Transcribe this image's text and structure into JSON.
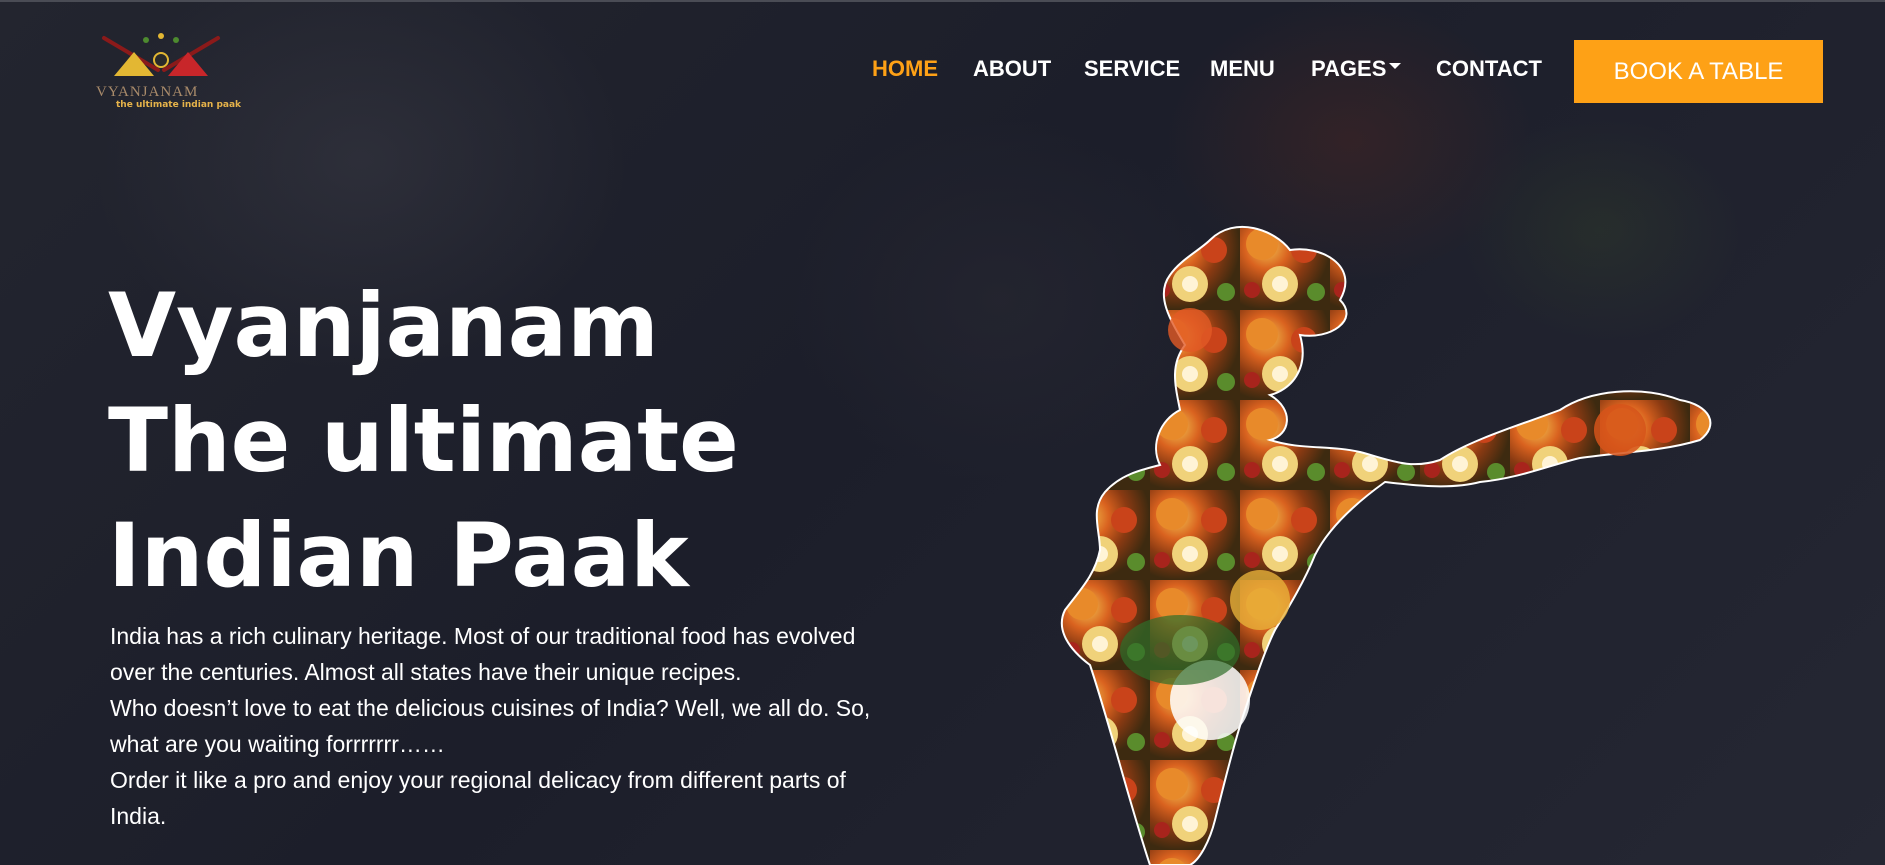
{
  "logo": {
    "name": "VYANJANAM",
    "tagline": "the ultimate indian paak"
  },
  "nav": {
    "items": [
      {
        "label": "HOME",
        "active": true
      },
      {
        "label": "ABOUT"
      },
      {
        "label": "SERVICE"
      },
      {
        "label": "MENU"
      },
      {
        "label": "PAGES",
        "dropdown": true
      },
      {
        "label": "CONTACT"
      }
    ],
    "cta": "BOOK A TABLE"
  },
  "hero": {
    "title_lines": [
      "Vyanjanam",
      "The ultimate",
      "Indian Paak"
    ],
    "description_lines": [
      "India has a rich culinary heritage. Most of our traditional food has evolved",
      "over the centuries. Almost all states have their unique recipes.",
      "Who doesn’t love to eat the delicious cuisines of India? Well, we all do. So,",
      "what are you waiting forrrrrrr……",
      "Order it like a pro and enjoy your regional delicacy from different parts of",
      "India."
    ]
  },
  "colors": {
    "accent": "#fea116",
    "background": "#1f2130",
    "text": "#ffffff"
  }
}
